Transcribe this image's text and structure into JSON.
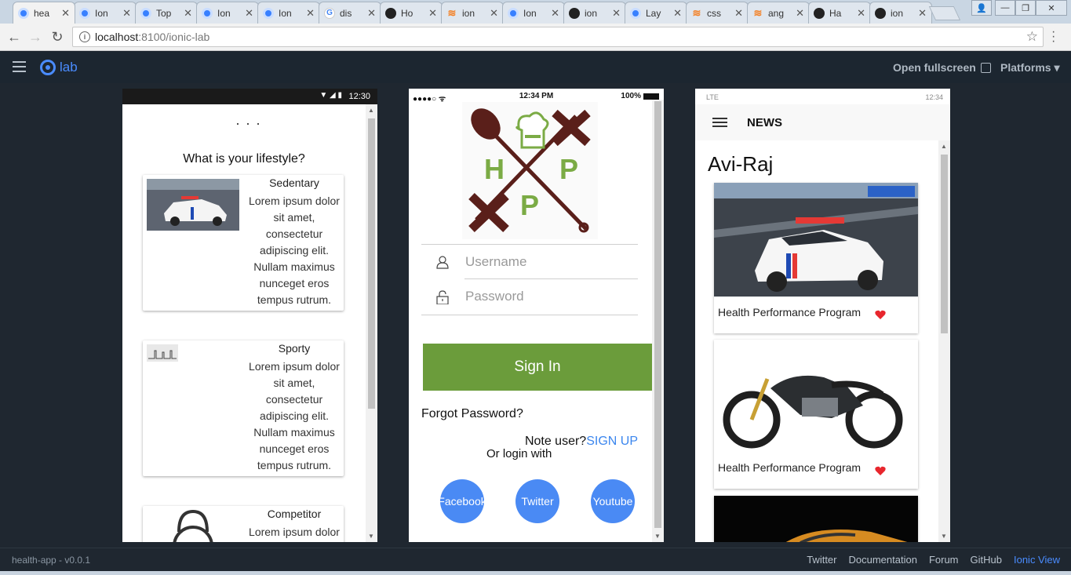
{
  "browser": {
    "tabs": [
      {
        "label": "hea",
        "favicon": "ionic-icon",
        "active": true
      },
      {
        "label": "Ion",
        "favicon": "ionic-icon"
      },
      {
        "label": "Top",
        "favicon": "ionic-icon"
      },
      {
        "label": "Ion",
        "favicon": "ionic-icon"
      },
      {
        "label": "Ion",
        "favicon": "ionic-icon"
      },
      {
        "label": "dis",
        "favicon": "google-icon"
      },
      {
        "label": "Ho",
        "favicon": "github-icon"
      },
      {
        "label": "ion",
        "favicon": "stackoverflow-icon"
      },
      {
        "label": "Ion",
        "favicon": "ionic-icon"
      },
      {
        "label": "ion",
        "favicon": "github-icon"
      },
      {
        "label": "Lay",
        "favicon": "ionic-icon"
      },
      {
        "label": "css",
        "favicon": "stackoverflow-icon"
      },
      {
        "label": "ang",
        "favicon": "stackoverflow-icon"
      },
      {
        "label": "Ha",
        "favicon": "github-icon"
      },
      {
        "label": "ion",
        "favicon": "github-icon"
      }
    ],
    "url_host": "localhost",
    "url_path": ":8100/ionic-lab"
  },
  "lab": {
    "logo_text": "lab",
    "open_fullscreen": "Open fullscreen",
    "platforms": "Platforms ▾"
  },
  "android": {
    "time": "12:30",
    "ellipsis": "· · ·",
    "question": "What is your lifestyle?",
    "cards": [
      {
        "title": "Sedentary",
        "desc": "Lorem ipsum dolor sit amet, consectetur adipiscing elit. Nullam maximus nunceget eros tempus rutrum."
      },
      {
        "title": "Sporty",
        "desc": "Lorem ipsum dolor sit amet, consectetur adipiscing elit. Nullam maximus nunceget eros tempus rutrum."
      },
      {
        "title": "Competitor",
        "desc": "Lorem ipsum dolor"
      }
    ]
  },
  "ios": {
    "time": "12:34 PM",
    "battery": "100%",
    "username_placeholder": "Username",
    "password_placeholder": "Password",
    "signin": "Sign In",
    "forgot": "Forgot Password?",
    "note_user": "Note user?",
    "sign_up": "SIGN UP",
    "or_login": "Or login with",
    "social": [
      "Facebook",
      "Twitter",
      "Youtube"
    ],
    "logo_letters": [
      "H",
      "P",
      "P"
    ]
  },
  "news": {
    "lte": "LTE",
    "time": "12:34",
    "title": "NEWS",
    "heading": "Avi-Raj",
    "cards": [
      {
        "caption": "Health Performance Program"
      },
      {
        "caption": "Health Performance Program"
      }
    ],
    "heart_color": "#e8262d"
  },
  "footer": {
    "version": "health-app - v0.0.1",
    "links": [
      "Twitter",
      "Documentation",
      "Forum",
      "GitHub",
      "Ionic View"
    ]
  },
  "colors": {
    "accent": "#4a8cff",
    "signin_green": "#6b9c3b",
    "social_blue": "#4a8af4"
  }
}
